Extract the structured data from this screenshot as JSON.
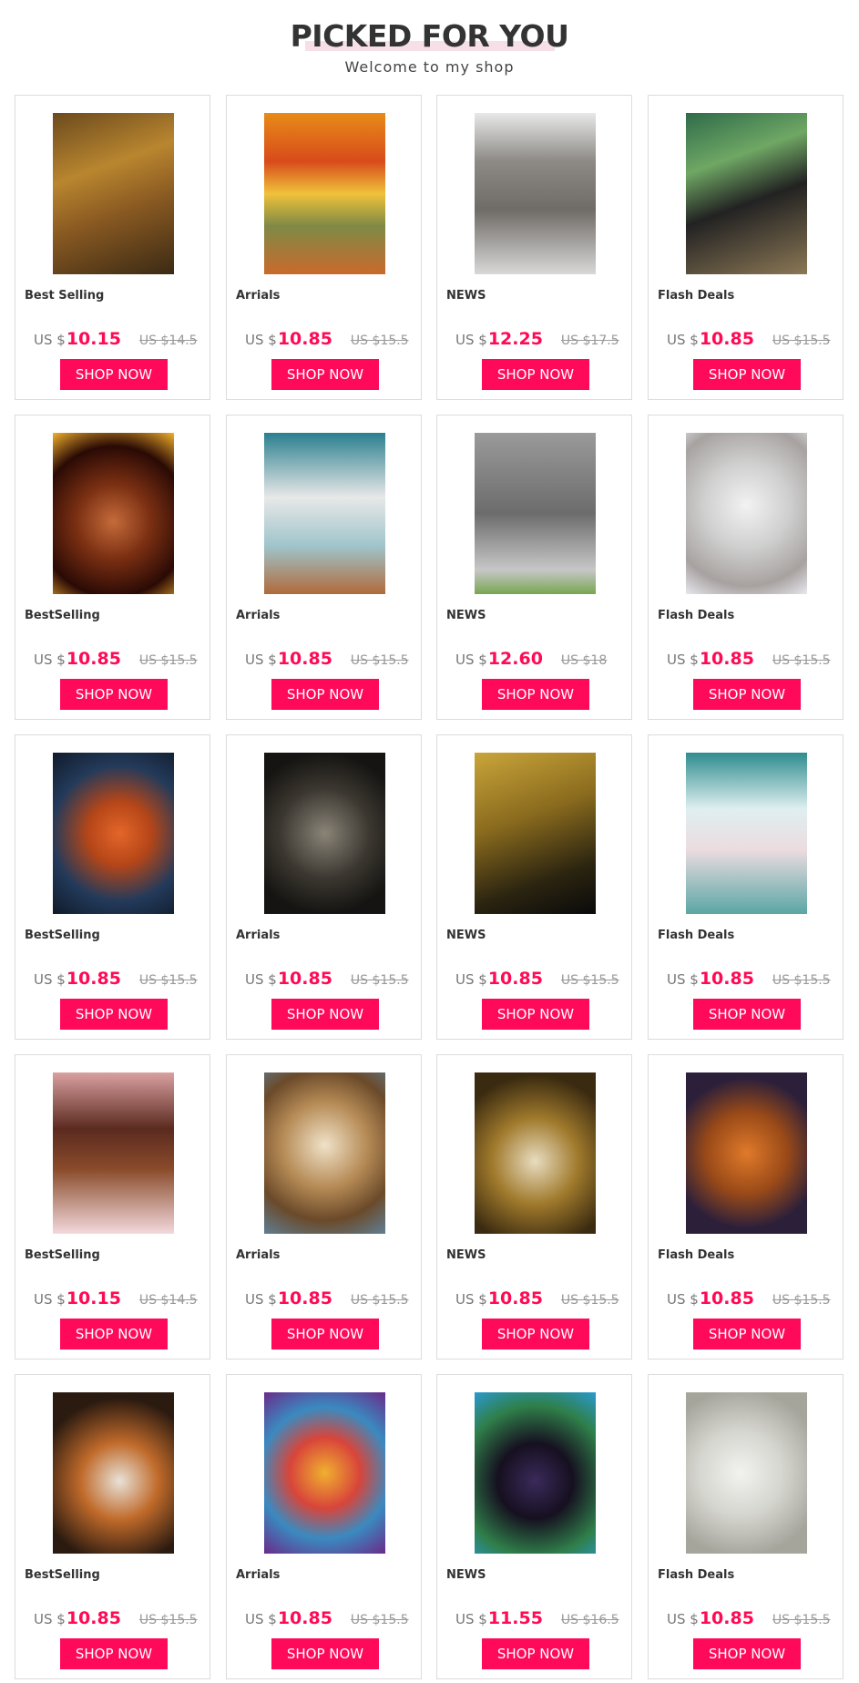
{
  "header": {
    "title": "PICKED FOR YOU",
    "subtitle": "Welcome to my shop"
  },
  "currency_prefix": "US $",
  "button_label": "SHOP NOW",
  "colors": {
    "accent": "#ff0a5a",
    "title_highlight": "#f6dfe6"
  },
  "products": [
    {
      "label": "Best Selling",
      "price": "10.15",
      "old": "US $14.5",
      "image": "leopard-in-autumn-forest"
    },
    {
      "label": "Arrials",
      "price": "10.85",
      "old": "US $15.5",
      "image": "fox-by-autumn-lake"
    },
    {
      "label": "NEWS",
      "price": "12.25",
      "old": "US $17.5",
      "image": "elephant-splash"
    },
    {
      "label": "Flash Deals",
      "price": "10.85",
      "old": "US $15.5",
      "image": "black-panther-in-jungle"
    },
    {
      "label": "BestSelling",
      "price": "10.85",
      "old": "US $15.5",
      "image": "fire-lion"
    },
    {
      "label": "Arrials",
      "price": "10.85",
      "old": "US $15.5",
      "image": "white-tiger-in-water"
    },
    {
      "label": "NEWS",
      "price": "12.60",
      "old": "US $18",
      "image": "elephant-with-calf"
    },
    {
      "label": "Flash Deals",
      "price": "10.85",
      "old": "US $15.5",
      "image": "snow-leopard"
    },
    {
      "label": "BestSelling",
      "price": "10.85",
      "old": "US $15.5",
      "image": "fox-in-snow"
    },
    {
      "label": "Arrials",
      "price": "10.85",
      "old": "US $15.5",
      "image": "lion-black-and-white"
    },
    {
      "label": "NEWS",
      "price": "10.85",
      "old": "US $15.5",
      "image": "golden-elephant"
    },
    {
      "label": "Flash Deals",
      "price": "10.85",
      "old": "US $15.5",
      "image": "white-lions-moon"
    },
    {
      "label": "BestSelling",
      "price": "10.15",
      "old": "US $14.5",
      "image": "tribal-horse"
    },
    {
      "label": "Arrials",
      "price": "10.85",
      "old": "US $15.5",
      "image": "cheetah"
    },
    {
      "label": "NEWS",
      "price": "10.85",
      "old": "US $15.5",
      "image": "lion-portrait"
    },
    {
      "label": "Flash Deals",
      "price": "10.85",
      "old": "US $15.5",
      "image": "tiger-portrait"
    },
    {
      "label": "BestSelling",
      "price": "10.85",
      "old": "US $15.5",
      "image": "tiger-with-leaves"
    },
    {
      "label": "Arrials",
      "price": "10.85",
      "old": "US $15.5",
      "image": "colorful-leopard"
    },
    {
      "label": "NEWS",
      "price": "11.55",
      "old": "US $16.5",
      "image": "black-panther-jungle-water"
    },
    {
      "label": "Flash Deals",
      "price": "10.85",
      "old": "US $15.5",
      "image": "white-lion"
    }
  ]
}
